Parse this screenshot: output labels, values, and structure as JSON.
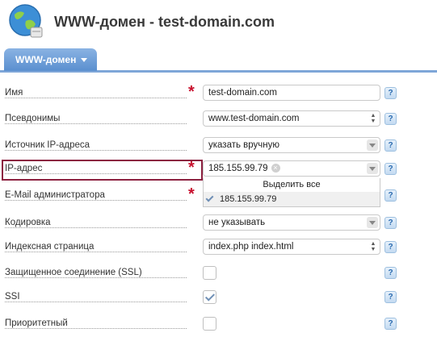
{
  "header": {
    "title": "WWW-домен - test-domain.com"
  },
  "tabs": [
    {
      "label": "WWW-домен"
    }
  ],
  "form": {
    "name": {
      "label": "Имя",
      "value": "test-domain.com"
    },
    "aliases": {
      "label": "Псевдонимы",
      "value": "www.test-domain.com"
    },
    "ip_source": {
      "label": "Источник IP-адреса",
      "value": "указать вручную"
    },
    "ip": {
      "label": "IP-адрес",
      "value": "185.155.99.79",
      "dropdown": {
        "select_all": "Выделить все",
        "option": "185.155.99.79"
      }
    },
    "admin_email": {
      "label": "E-Mail администратора"
    },
    "charset": {
      "label": "Кодировка",
      "value": "не указывать"
    },
    "index_page": {
      "label": "Индексная страница",
      "value": "index.php index.html"
    },
    "ssl": {
      "label": "Защищенное соединение (SSL)",
      "checked": false
    },
    "ssi": {
      "label": "SSI",
      "checked": true
    },
    "priority": {
      "label": "Приоритетный",
      "checked": false
    }
  },
  "help_symbol": "?",
  "required_symbol": "*"
}
